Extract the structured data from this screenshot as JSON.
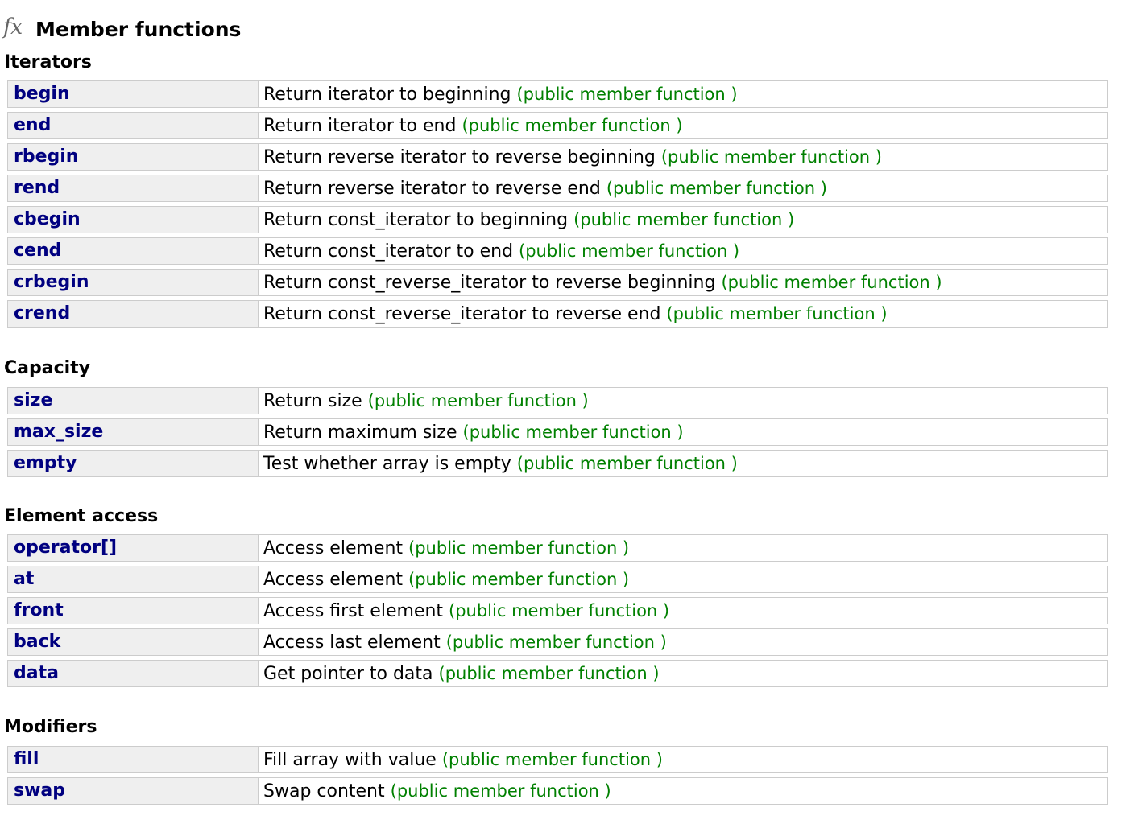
{
  "page": {
    "icon": "fx-icon",
    "title": "Member functions"
  },
  "sections": [
    {
      "heading": "Iterators",
      "functions": [
        {
          "name": "begin",
          "description": "Return iterator to beginning",
          "kind": "(public member function )"
        },
        {
          "name": "end",
          "description": "Return iterator to end",
          "kind": "(public member function )"
        },
        {
          "name": "rbegin",
          "description": "Return reverse iterator to reverse beginning",
          "kind": "(public member function )"
        },
        {
          "name": "rend",
          "description": "Return reverse iterator to reverse end",
          "kind": "(public member function )"
        },
        {
          "name": "cbegin",
          "description": "Return const_iterator to beginning",
          "kind": "(public member function )"
        },
        {
          "name": "cend",
          "description": "Return const_iterator to end",
          "kind": "(public member function )"
        },
        {
          "name": "crbegin",
          "description": "Return const_reverse_iterator to reverse beginning",
          "kind": "(public member function )"
        },
        {
          "name": "crend",
          "description": "Return const_reverse_iterator to reverse end",
          "kind": "(public member function )"
        }
      ]
    },
    {
      "heading": "Capacity",
      "functions": [
        {
          "name": "size",
          "description": "Return size",
          "kind": "(public member function )"
        },
        {
          "name": "max_size",
          "description": "Return maximum size",
          "kind": "(public member function )"
        },
        {
          "name": "empty",
          "description": "Test whether array is empty",
          "kind": "(public member function )"
        }
      ]
    },
    {
      "heading": "Element access",
      "functions": [
        {
          "name": "operator[]",
          "description": "Access element",
          "kind": "(public member function )"
        },
        {
          "name": "at",
          "description": "Access element",
          "kind": "(public member function )"
        },
        {
          "name": "front",
          "description": "Access first element",
          "kind": "(public member function )"
        },
        {
          "name": "back",
          "description": "Access last element",
          "kind": "(public member function )"
        },
        {
          "name": "data",
          "description": "Get pointer to data",
          "kind": "(public member function )"
        }
      ]
    },
    {
      "heading": "Modifiers",
      "functions": [
        {
          "name": "fill",
          "description": "Fill array with value",
          "kind": "(public member function )"
        },
        {
          "name": "swap",
          "description": "Swap content",
          "kind": "(public member function )"
        }
      ]
    }
  ],
  "colors": {
    "function_link": "#000080",
    "function_kind": "#008000",
    "name_cell_background": "#efefef",
    "border": "#cccccc"
  }
}
